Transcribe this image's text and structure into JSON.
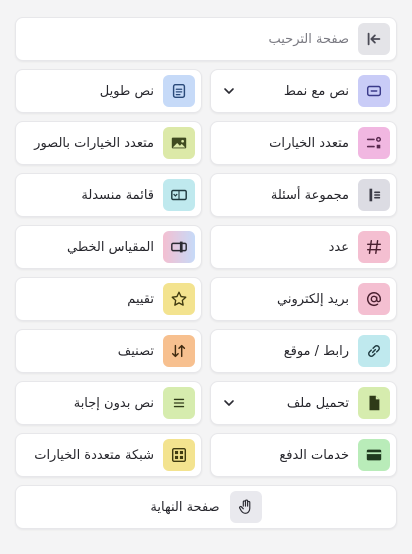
{
  "welcome": {
    "label": "صفحة الترحيب",
    "icon": "collapse-left-icon",
    "color": "#e4e4e8"
  },
  "items": [
    {
      "label": "نص مع نمط",
      "icon": "text-style-icon",
      "color": "#c9ccf7",
      "dropdown": true
    },
    {
      "label": "نص طويل",
      "icon": "long-text-icon",
      "color": "#c6daf8"
    },
    {
      "label": "متعدد الخيارات",
      "icon": "multiple-choice-icon",
      "color": "#f1b7e1"
    },
    {
      "label": "متعدد الخيارات بالصور",
      "icon": "picture-choice-icon",
      "color": "#dce9a8"
    },
    {
      "label": "مجموعة أسئلة",
      "icon": "question-group-icon",
      "color": "#dcdce3"
    },
    {
      "label": "قائمة منسدلة",
      "icon": "dropdown-list-icon",
      "color": "#bfe9ee"
    },
    {
      "label": "عدد",
      "icon": "number-icon",
      "color": "#f4bfd1"
    },
    {
      "label": "المقياس الخطي",
      "icon": "linear-scale-icon",
      "color": "#d8c9f2"
    },
    {
      "label": "بريد إلكتروني",
      "icon": "email-icon",
      "color": "#f4bfd1"
    },
    {
      "label": "تقييم",
      "icon": "star-icon",
      "color": "#f3e38f"
    },
    {
      "label": "رابط / موقع",
      "icon": "link-icon",
      "color": "#bfe9ee"
    },
    {
      "label": "تصنيف",
      "icon": "ranking-icon",
      "color": "#f7c08f"
    },
    {
      "label": "تحميل ملف",
      "icon": "file-upload-icon",
      "color": "#d6ecae",
      "dropdown": true
    },
    {
      "label": "نص بدون إجابة",
      "icon": "statement-icon",
      "color": "#d6ecae"
    },
    {
      "label": "خدمات الدفع",
      "icon": "payment-icon",
      "color": "#b9ecb9"
    },
    {
      "label": "شبكة متعددة الخيارات",
      "icon": "matrix-icon",
      "color": "#f3e38f"
    }
  ],
  "thanks": {
    "label": "صفحة النهاية",
    "icon": "wave-hand-icon",
    "color": "#e9e9ee"
  }
}
